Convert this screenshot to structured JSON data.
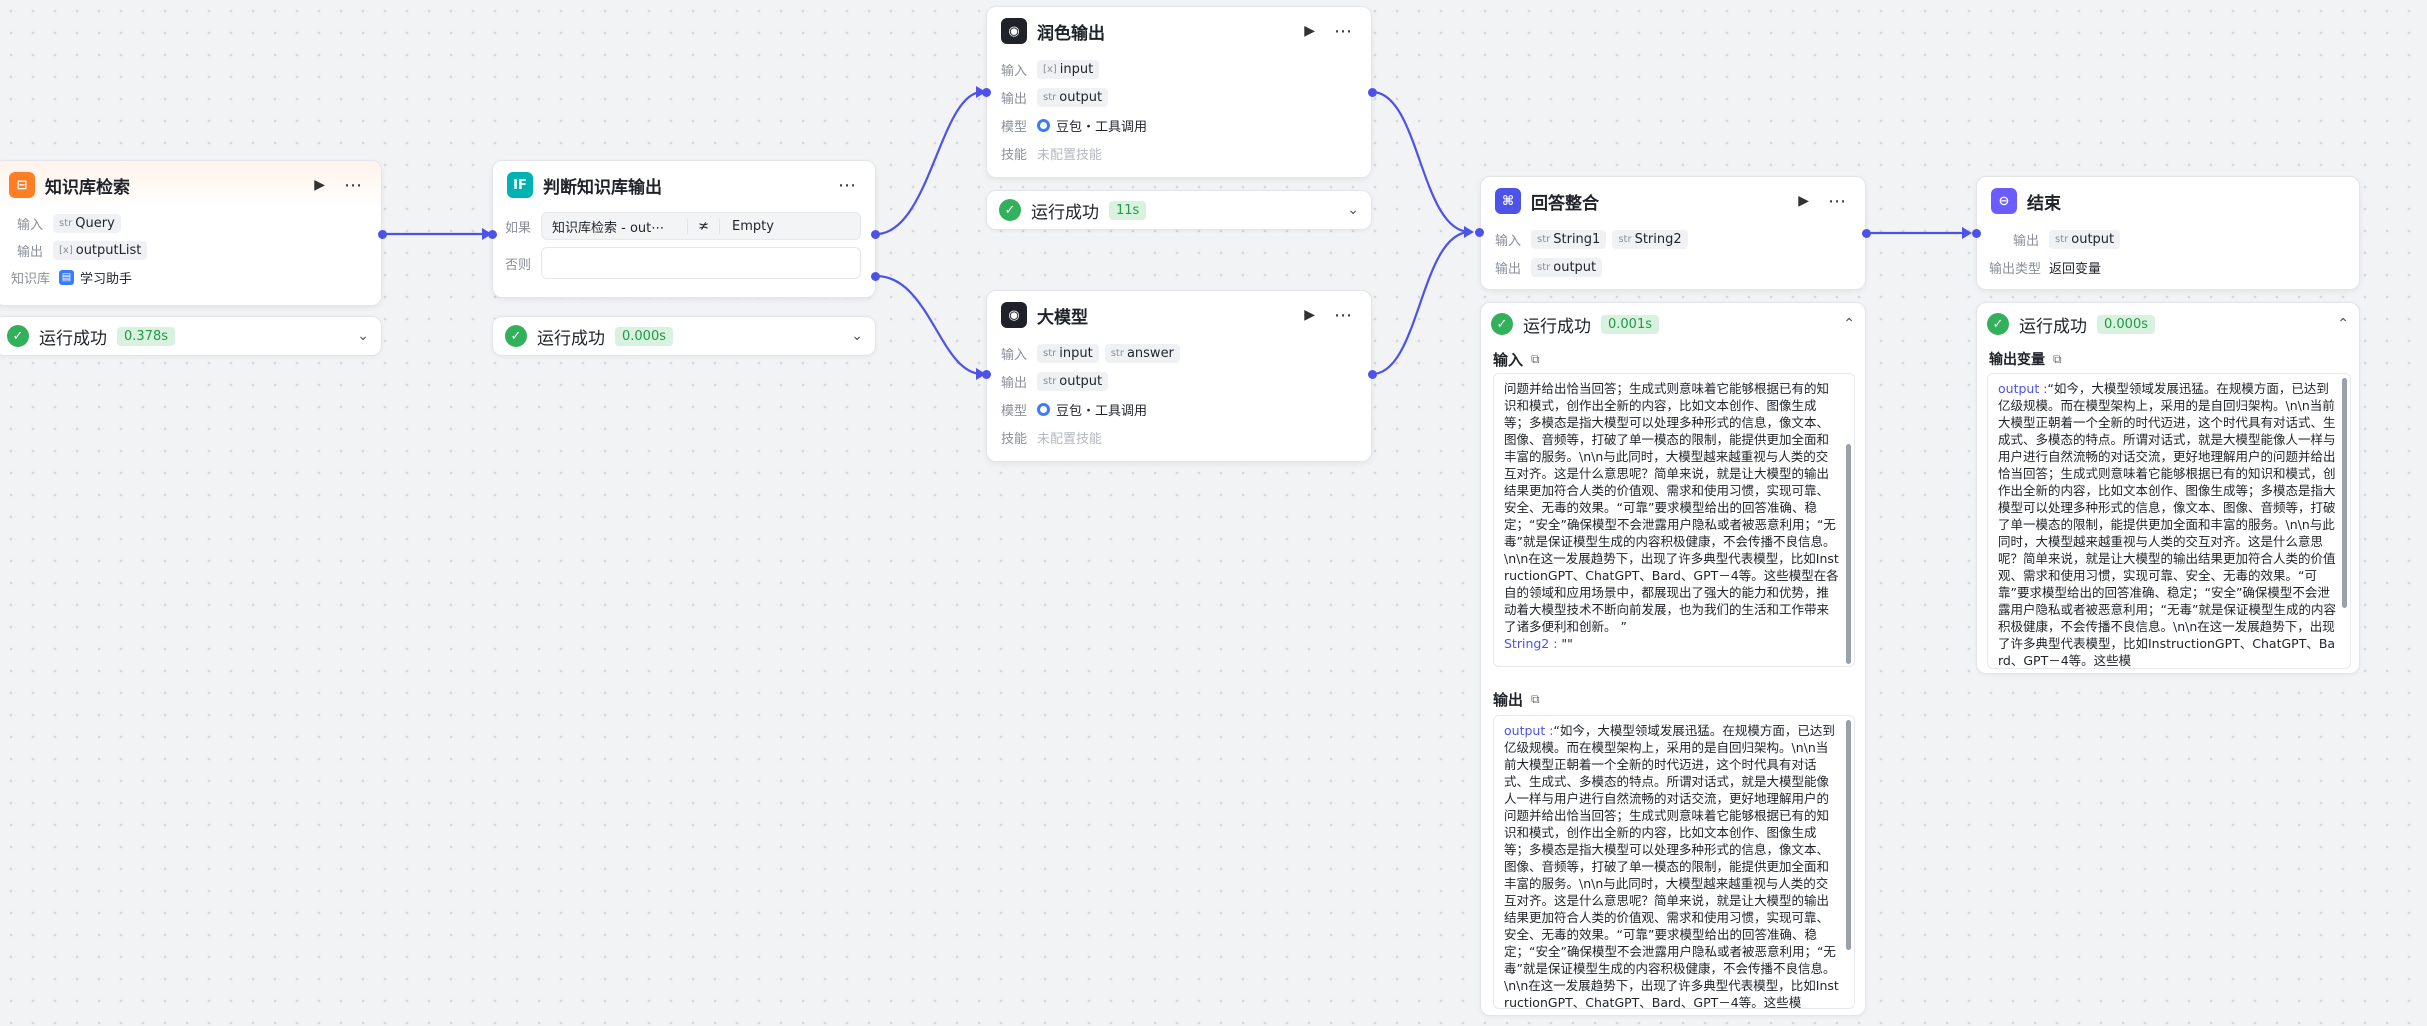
{
  "labels": {
    "input": "输入",
    "output": "输出",
    "model": "模型",
    "skill": "技能",
    "knowledge": "知识库",
    "if": "如果",
    "else": "否则",
    "output_type": "输出类型"
  },
  "success_text": "运行成功",
  "kb_node": {
    "title": "知识库检索",
    "input_type": "str",
    "input": "Query",
    "output_type": "[x]",
    "output": "outputList",
    "kb_name": "学习助手",
    "time": "0.378s"
  },
  "cond_node": {
    "title": "判断知识库输出",
    "left": "知识库检索 - out⋯",
    "op": "≭",
    "right": "Empty",
    "time": "0.000s"
  },
  "polish_node": {
    "title": "润色输出",
    "input_type": "[x]",
    "input": "input",
    "output_type": "str",
    "output": "output",
    "model": "豆包・工具调用",
    "skill": "未配置技能",
    "time": "11s"
  },
  "llm_node": {
    "title": "大模型",
    "input_types": [
      "str",
      "str"
    ],
    "inputs": [
      "input",
      "answer"
    ],
    "output_type": "str",
    "output": "output",
    "model": "豆包・工具调用",
    "skill": "未配置技能"
  },
  "merge_node": {
    "title": "回答整合",
    "input_types": [
      "str",
      "str"
    ],
    "inputs": [
      "String1",
      "String2"
    ],
    "output_type": "str",
    "output": "output",
    "time": "0.001s",
    "in_title": "输入",
    "in_text": "问题并给出恰当回答；生成式则意味着它能够根据已有的知识和模式，创作出全新的内容，比如文本创作、图像生成等；多模态是指大模型可以处理多种形式的信息，像文本、图像、音频等，打破了单一模态的限制，能提供更加全面和丰富的服务。\\n\\n与此同时，大模型越来越重视与人类的交互对齐。这是什么意思呢？简单来说，就是让大模型的输出结果更加符合人类的价值观、需求和使用习惯，实现可靠、安全、无毒的效果。“可靠”要求模型给出的回答准确、稳定；“安全”确保模型不会泄露用户隐私或者被恶意利用；“无毒”就是保证模型生成的内容积极健康，不会传播不良信息。\\n\\n在这一发展趋势下，出现了许多典型代表模型，比如InstructionGPT、ChatGPT、Bard、GPT－4等。这些模型在各自的领域和应用场景中，都展现出了强大的能力和优势，推动着大模型技术不断向前发展，也为我们的生活和工作带来了诸多便利和创新。 ”",
    "in_key2": "String2 :",
    "in_val2": " \"\"",
    "out_title": "输出",
    "out_key": "output :",
    "out_text": "“如今，大模型领域发展迅猛。在规模方面，已达到亿级规模。而在模型架构上，采用的是自回归架构。\\n\\n当前大模型正朝着一个全新的时代迈进，这个时代具有对话式、生成式、多模态的特点。所谓对话式，就是大模型能像人一样与用户进行自然流畅的对话交流，更好地理解用户的问题并给出恰当回答；生成式则意味着它能够根据已有的知识和模式，创作出全新的内容，比如文本创作、图像生成等；多模态是指大模型可以处理多种形式的信息，像文本、图像、音频等，打破了单一模态的限制，能提供更加全面和丰富的服务。\\n\\n与此同时，大模型越来越重视与人类的交互对齐。这是什么意思呢？简单来说，就是让大模型的输出结果更加符合人类的价值观、需求和使用习惯，实现可靠、安全、无毒的效果。“可靠”要求模型给出的回答准确、稳定；“安全”确保模型不会泄露用户隐私或者被恶意利用；“无毒”就是保证模型生成的内容积极健康，不会传播不良信息。\\n\\n在这一发展趋势下，出现了许多典型代表模型，比如InstructionGPT、ChatGPT、Bard、GPT－4等。这些模"
  },
  "end_node": {
    "title": "结束",
    "output_type": "str",
    "output": "output",
    "out_type_value": "返回变量",
    "time": "0.000s",
    "var_title": "输出变量",
    "out_key": "output :",
    "out_text": "“如今，大模型领域发展迅猛。在规模方面，已达到亿级规模。而在模型架构上，采用的是自回归架构。\\n\\n当前大模型正朝着一个全新的时代迈进，这个时代具有对话式、生成式、多模态的特点。所谓对话式，就是大模型能像人一样与用户进行自然流畅的对话交流，更好地理解用户的问题并给出恰当回答；生成式则意味着它能够根据已有的知识和模式，创作出全新的内容，比如文本创作、图像生成等；多模态是指大模型可以处理多种形式的信息，像文本、图像、音频等，打破了单一模态的限制，能提供更加全面和丰富的服务。\\n\\n与此同时，大模型越来越重视与人类的交互对齐。这是什么意思呢？简单来说，就是让大模型的输出结果更加符合人类的价值观、需求和使用习惯，实现可靠、安全、无毒的效果。“可靠”要求模型给出的回答准确、稳定；“安全”确保模型不会泄露用户隐私或者被恶意利用；“无毒”就是保证模型生成的内容积极健康，不会传播不良信息。\\n\\n在这一发展趋势下，出现了许多典型代表模型，比如InstructionGPT、ChatGPT、Bard、GPT－4等。这些模"
  },
  "colors": {
    "edge": "#4d53e8",
    "success": "#33b05b",
    "kb_icon": "#ff7d25",
    "cond_icon": "#00b2b2",
    "llm_icon": "#1f2329",
    "merge_icon": "#4d53e8",
    "end_icon": "#6b5cff"
  },
  "icons": {
    "run": "play-icon",
    "more": "more-icon",
    "collapse": "chevron-icon",
    "copy": "copy-icon"
  }
}
